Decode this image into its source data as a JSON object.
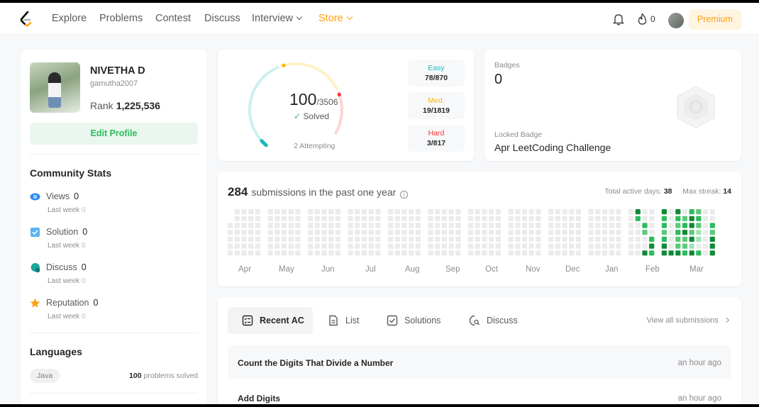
{
  "nav": {
    "items": [
      "Explore",
      "Problems",
      "Contest",
      "Discuss",
      "Interview",
      "Store"
    ],
    "streak_count": "0",
    "premium_label": "Premium"
  },
  "profile": {
    "name": "NIVETHA D",
    "username": "gamutha2007",
    "rank_label": "Rank",
    "rank_value": "1,225,536",
    "edit_label": "Edit Profile"
  },
  "community": {
    "title": "Community Stats",
    "stats": [
      {
        "label": "Views",
        "value": "0",
        "last_week_label": "Last week",
        "last_week_value": "0"
      },
      {
        "label": "Solution",
        "value": "0",
        "last_week_label": "Last week",
        "last_week_value": "0"
      },
      {
        "label": "Discuss",
        "value": "0",
        "last_week_label": "Last week",
        "last_week_value": "0"
      },
      {
        "label": "Reputation",
        "value": "0",
        "last_week_label": "Last week",
        "last_week_value": "0"
      }
    ]
  },
  "languages": {
    "title": "Languages",
    "items": [
      {
        "name": "Java",
        "count": "100",
        "suffix": "problems solved"
      }
    ]
  },
  "solved": {
    "count": "100",
    "total": "/3506",
    "label": "Solved",
    "attempting": "2 Attempting",
    "progress_fraction": 0.0285,
    "difficulties": [
      {
        "label": "Easy",
        "value": "78/870",
        "color": "#1cb8b8",
        "fraction": 0.0897
      },
      {
        "label": "Med.",
        "value": "19/1819",
        "color": "#ffb700",
        "fraction": 0.0104
      },
      {
        "label": "Hard",
        "value": "3/817",
        "color": "#f63737",
        "fraction": 0.0037
      }
    ]
  },
  "badges": {
    "title": "Badges",
    "count": "0",
    "locked_label": "Locked Badge",
    "locked_name": "Apr LeetCoding Challenge"
  },
  "submissions": {
    "count": "284",
    "text": "submissions in the past one year",
    "active_days_label": "Total active days:",
    "active_days": "38",
    "max_streak_label": "Max streak:",
    "max_streak": "14",
    "months": [
      "Apr",
      "May",
      "Jun",
      "Jul",
      "Aug",
      "Sep",
      "Oct",
      "Nov",
      "Dec",
      "Jan",
      "Feb",
      "Mar"
    ],
    "colors": {
      "empty": "#ebebeb",
      "l1": "#a1e3b3",
      "l2": "#5cc97b",
      "l3": "#2cbb5d",
      "l4": "#0f8a35"
    }
  },
  "tabs": {
    "items": [
      "Recent AC",
      "List",
      "Solutions",
      "Discuss"
    ],
    "view_all": "View all submissions"
  },
  "recent": [
    {
      "title": "Count the Digits That Divide a Number",
      "time": "an hour ago"
    },
    {
      "title": "Add Digits",
      "time": "an hour ago"
    }
  ]
}
